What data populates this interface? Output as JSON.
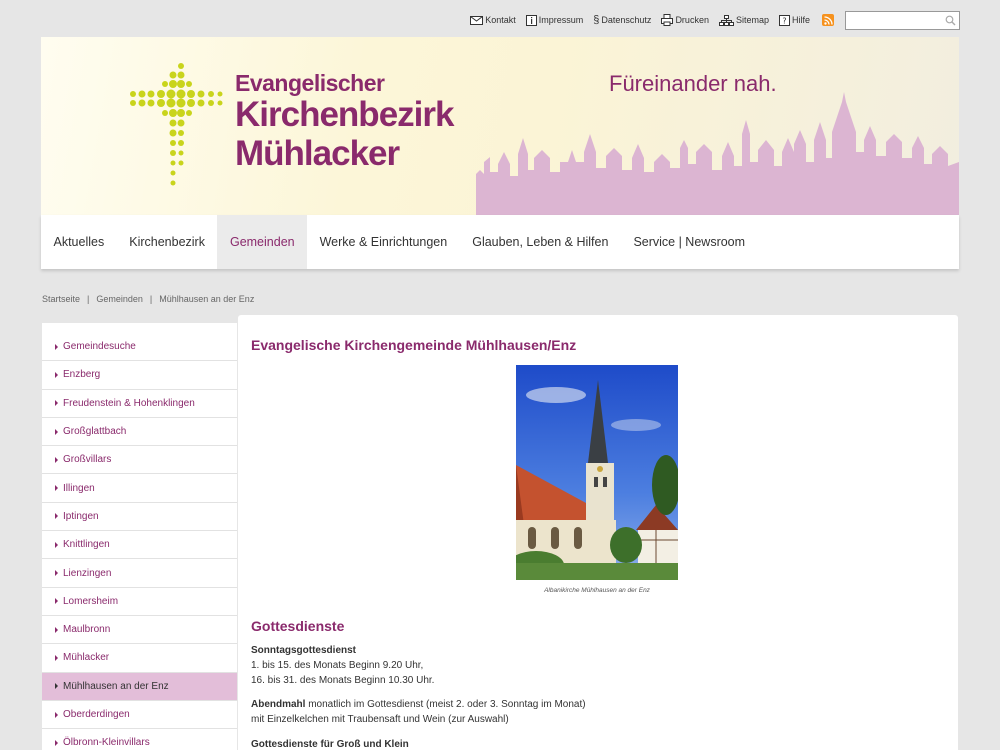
{
  "utility": {
    "kontakt": "Kontakt",
    "impressum": "Impressum",
    "datenschutz": "Datenschutz",
    "drucken": "Drucken",
    "sitemap": "Sitemap",
    "hilfe": "Hilfe",
    "search_placeholder": ""
  },
  "banner": {
    "line1": "Evangelischer",
    "line2": "Kirchenbezirk",
    "line3": "Mühlacker",
    "slogan": "Füreinander nah."
  },
  "nav": {
    "items": [
      "Aktuelles",
      "Kirchenbezirk",
      "Gemeinden",
      "Werke & Einrichtungen",
      "Glauben, Leben & Hilfen",
      "Service | Newsroom"
    ],
    "active_index": 2
  },
  "breadcrumb": {
    "items": [
      "Startseite",
      "Gemeinden",
      "Mühlhausen an der Enz"
    ],
    "separator": "|"
  },
  "sidebar": {
    "items": [
      "Gemeindesuche",
      "Enzberg",
      "Freudenstein & Hohenklingen",
      "Großglattbach",
      "Großvillars",
      "Illingen",
      "Iptingen",
      "Knittlingen",
      "Lienzingen",
      "Lomersheim",
      "Maulbronn",
      "Mühlacker",
      "Mühlhausen an der Enz",
      "Oberderdingen",
      "Ölbronn-Kleinvillars"
    ],
    "active_index": 12
  },
  "content": {
    "title": "Evangelische Kirchengemeinde Mühlhausen/Enz",
    "caption": "Albanikirche Mühlhausen an der Enz",
    "section_title": "Gottesdienste",
    "sunday_label": "Sonntagsgottesdienst",
    "sunday_line1": "1. bis 15. des Monats Beginn 9.20 Uhr,",
    "sunday_line2": "16. bis 31. des Monats Beginn 10.30 Uhr.",
    "abendmahl_label": "Abendmahl",
    "abendmahl_text": " monatlich im Gottesdienst (meist 2. oder 3. Sonntag im Monat)",
    "abendmahl_line2": "mit Einzelkelchen mit Traubensaft und Wein (zur Auswahl)",
    "gross_klein_label": "Gottesdienste für Groß und Klein"
  },
  "colors": {
    "accent": "#8a2a6c",
    "logo_cross": "#c9d41c",
    "skyline": "#dcb5d2",
    "active_sidebar": "#e3bed9"
  }
}
